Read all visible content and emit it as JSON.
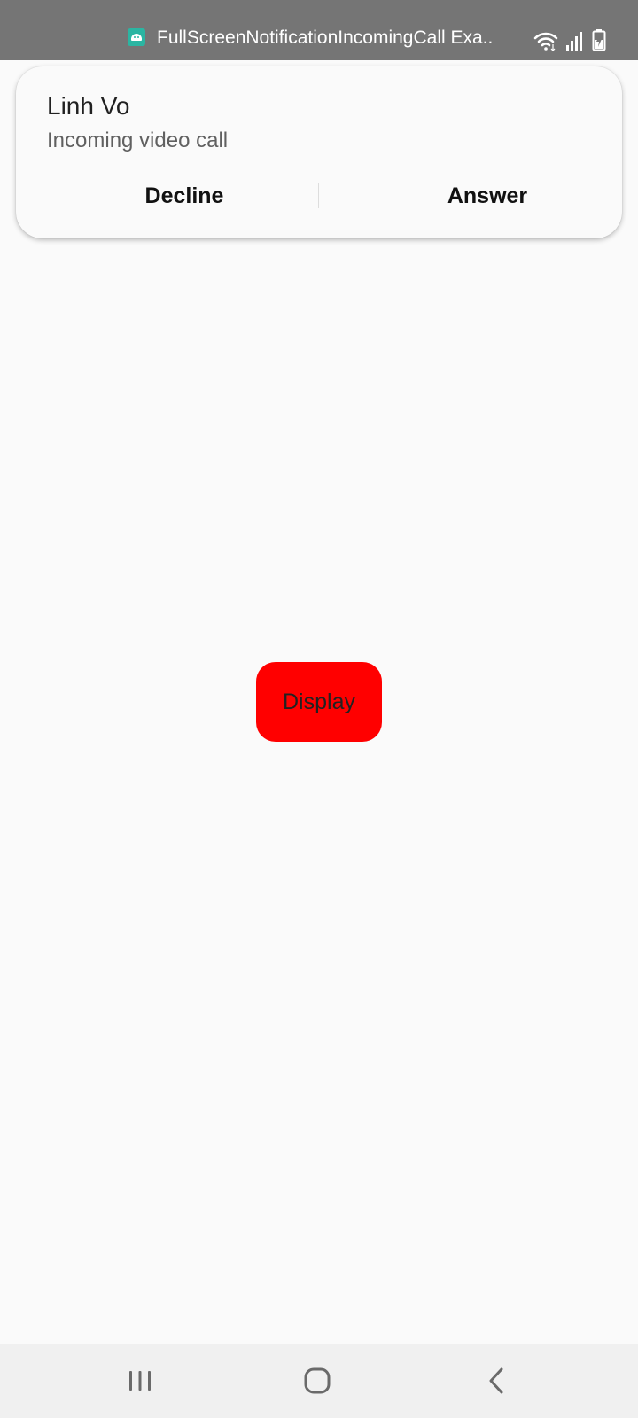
{
  "status_bar": {
    "title": "FullScreenNotificationIncomingCall Exa..",
    "app_icon": "android-icon",
    "icons": [
      "wifi-icon",
      "signal-icon",
      "battery-charging-icon"
    ]
  },
  "notification": {
    "caller_name": "Linh Vo",
    "subtitle": "Incoming video call",
    "decline_label": "Decline",
    "answer_label": "Answer"
  },
  "main": {
    "display_button_label": "Display",
    "display_button_color": "#ff0000"
  },
  "nav_bar": {
    "buttons": [
      "recent-apps-icon",
      "home-icon",
      "back-icon"
    ]
  },
  "colors": {
    "status_bar": "#757575",
    "background": "#fafafa",
    "app_icon": "#2bb5a2"
  }
}
